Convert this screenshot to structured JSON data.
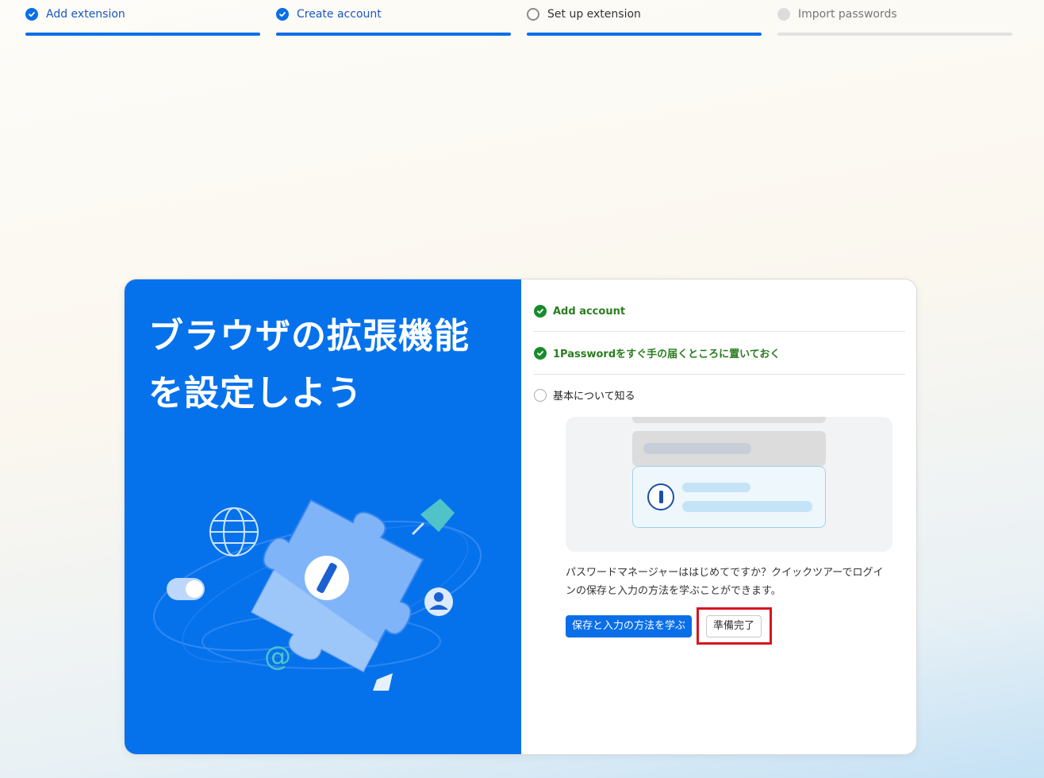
{
  "stepper": {
    "steps": [
      {
        "label": "Add extension",
        "state": "done"
      },
      {
        "label": "Create account",
        "state": "done"
      },
      {
        "label": "Set up extension",
        "state": "current"
      },
      {
        "label": "Import passwords",
        "state": "todo"
      }
    ]
  },
  "card": {
    "heading": "ブラウザの拡張機能を設定しよう",
    "checklist": [
      {
        "label": "Add account",
        "status": "complete"
      },
      {
        "label": "1Passwordをすぐ手の届くところに置いておく",
        "status": "complete"
      },
      {
        "label": "基本について知る",
        "status": "pending"
      }
    ],
    "description": "パスワードマネージャーははじめてですか？クイックツアーでログインの保存と入力の方法を学ぶことができます。",
    "primary_button": "保存と入力の方法を学ぶ",
    "secondary_button": "準備完了"
  },
  "colors": {
    "accent": "#0a6ee8",
    "panel_blue": "#0572ec",
    "success_green": "#198b2d",
    "highlight_red": "#d7151f"
  }
}
